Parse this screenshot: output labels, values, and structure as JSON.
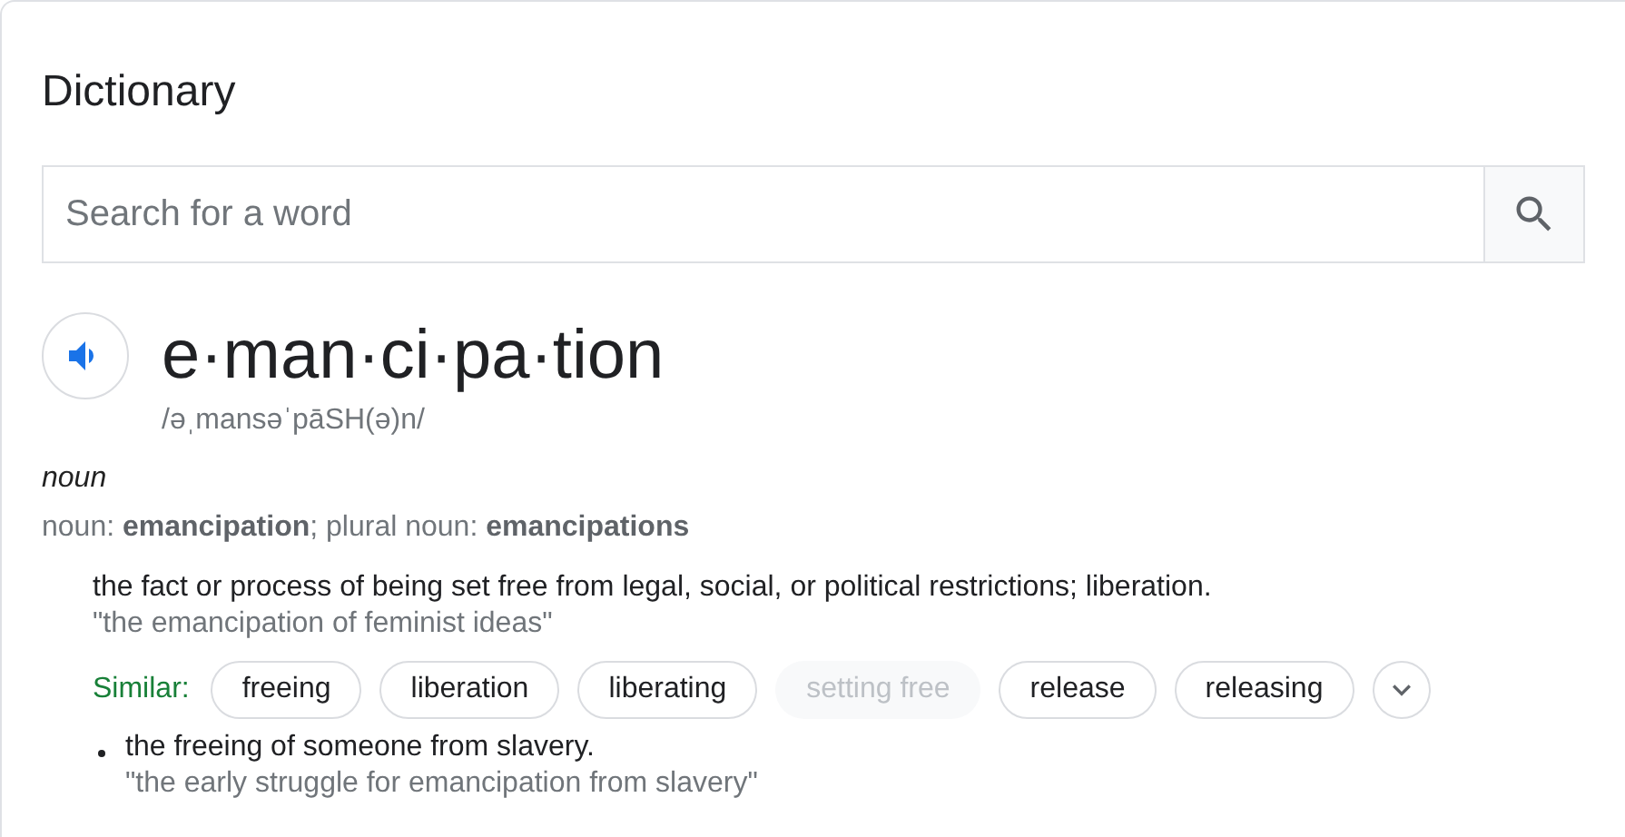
{
  "title": "Dictionary",
  "search": {
    "placeholder": "Search for a word"
  },
  "entry": {
    "word": "e·man·ci·pa·tion",
    "pronunciation": "/əˌmansəˈpāSH(ə)n/",
    "part_of_speech": "noun",
    "forms": "noun: **emancipation**; plural noun: **emancipations**",
    "senses": [
      {
        "definition": "the fact or process of being set free from legal, social, or political restrictions; liberation.",
        "example": "\"the emancipation of feminist ideas\"",
        "bulleted": false,
        "similar_label": "Similar:",
        "similar": [
          {
            "label": "freeing",
            "disabled": false
          },
          {
            "label": "liberation",
            "disabled": false
          },
          {
            "label": "liberating",
            "disabled": false
          },
          {
            "label": "setting free",
            "disabled": true
          },
          {
            "label": "release",
            "disabled": false
          },
          {
            "label": "releasing",
            "disabled": false
          }
        ],
        "more": true
      },
      {
        "definition": "the freeing of someone from slavery.",
        "example": "\"the early struggle for emancipation from slavery\"",
        "bulleted": true
      }
    ]
  }
}
